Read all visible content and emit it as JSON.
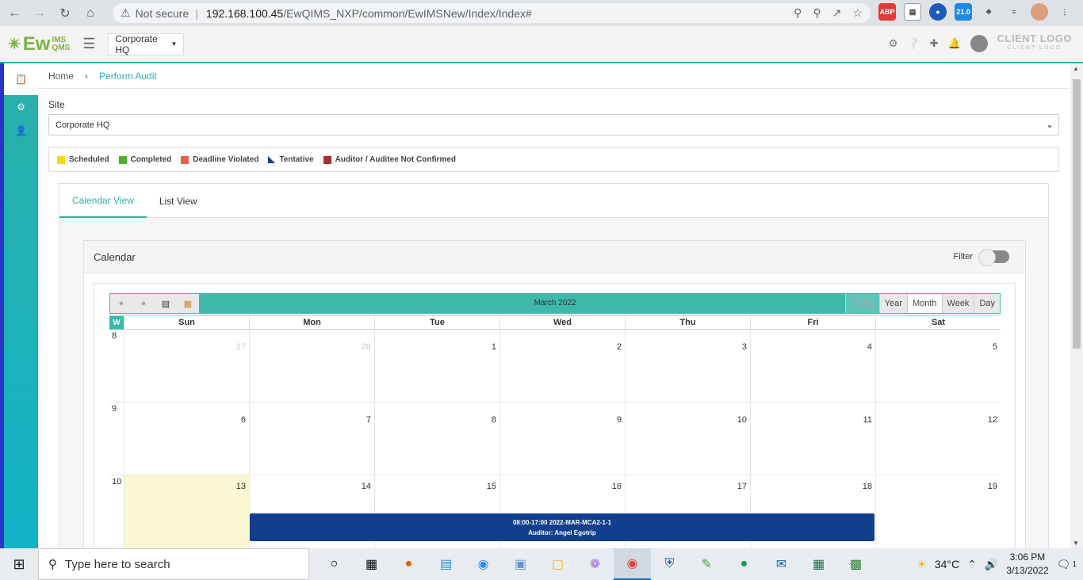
{
  "browser": {
    "security": "Not secure",
    "url_host": "192.168.100.45",
    "url_path": "/EwQIMS_NXP/common/EwIMSNew/Index/Index#",
    "ext_badge": "21.0"
  },
  "header": {
    "logo_main": "Ew",
    "logo_sup": "IMS",
    "logo_sub": "QMS",
    "site": "Corporate HQ",
    "client_logo": "CLIENT LOGO",
    "client_logo_sub": "CLIENT LOGO"
  },
  "breadcrumb": {
    "home": "Home",
    "current": "Perform Audit"
  },
  "site_field": {
    "label": "Site",
    "value": "Corporate HQ"
  },
  "legend": [
    {
      "label": "Scheduled",
      "color": "#f5d90a"
    },
    {
      "label": "Completed",
      "color": "#4caf2b"
    },
    {
      "label": "Deadline Violated",
      "color": "#e8604e"
    },
    {
      "label": "Tentative",
      "color": "#1a3d8f"
    },
    {
      "label": "Auditor / Auditee Not Confirmed",
      "color": "#a3302e"
    }
  ],
  "tabs": {
    "calendar": "Calendar View",
    "list": "List View"
  },
  "calendar": {
    "heading": "Calendar",
    "filter_label": "Filter",
    "month_title": "March 2022",
    "views": {
      "today": "Today",
      "year": "Year",
      "month": "Month",
      "week": "Week",
      "day": "Day"
    },
    "week_header": "W",
    "days": {
      "sun": "Sun",
      "mon": "Mon",
      "tue": "Tue",
      "wed": "Wed",
      "thu": "Thu",
      "fri": "Fri",
      "sat": "Sat"
    },
    "weeks": [
      {
        "num": "8",
        "dates": [
          "27",
          "28",
          "1",
          "2",
          "3",
          "4",
          "5"
        ]
      },
      {
        "num": "9",
        "dates": [
          "6",
          "7",
          "8",
          "9",
          "10",
          "11",
          "12"
        ]
      },
      {
        "num": "10",
        "dates": [
          "13",
          "14",
          "15",
          "16",
          "17",
          "18",
          "19"
        ]
      }
    ],
    "event": {
      "line1": "08:00-17:00 2022-MAR-MCA2-1-1",
      "line2": "Auditor: Angel Egotrip"
    }
  },
  "taskbar": {
    "search_placeholder": "Type here to search",
    "weather": "34°C",
    "time": "3:06 PM",
    "date": "3/13/2022",
    "notif_count": "1"
  }
}
